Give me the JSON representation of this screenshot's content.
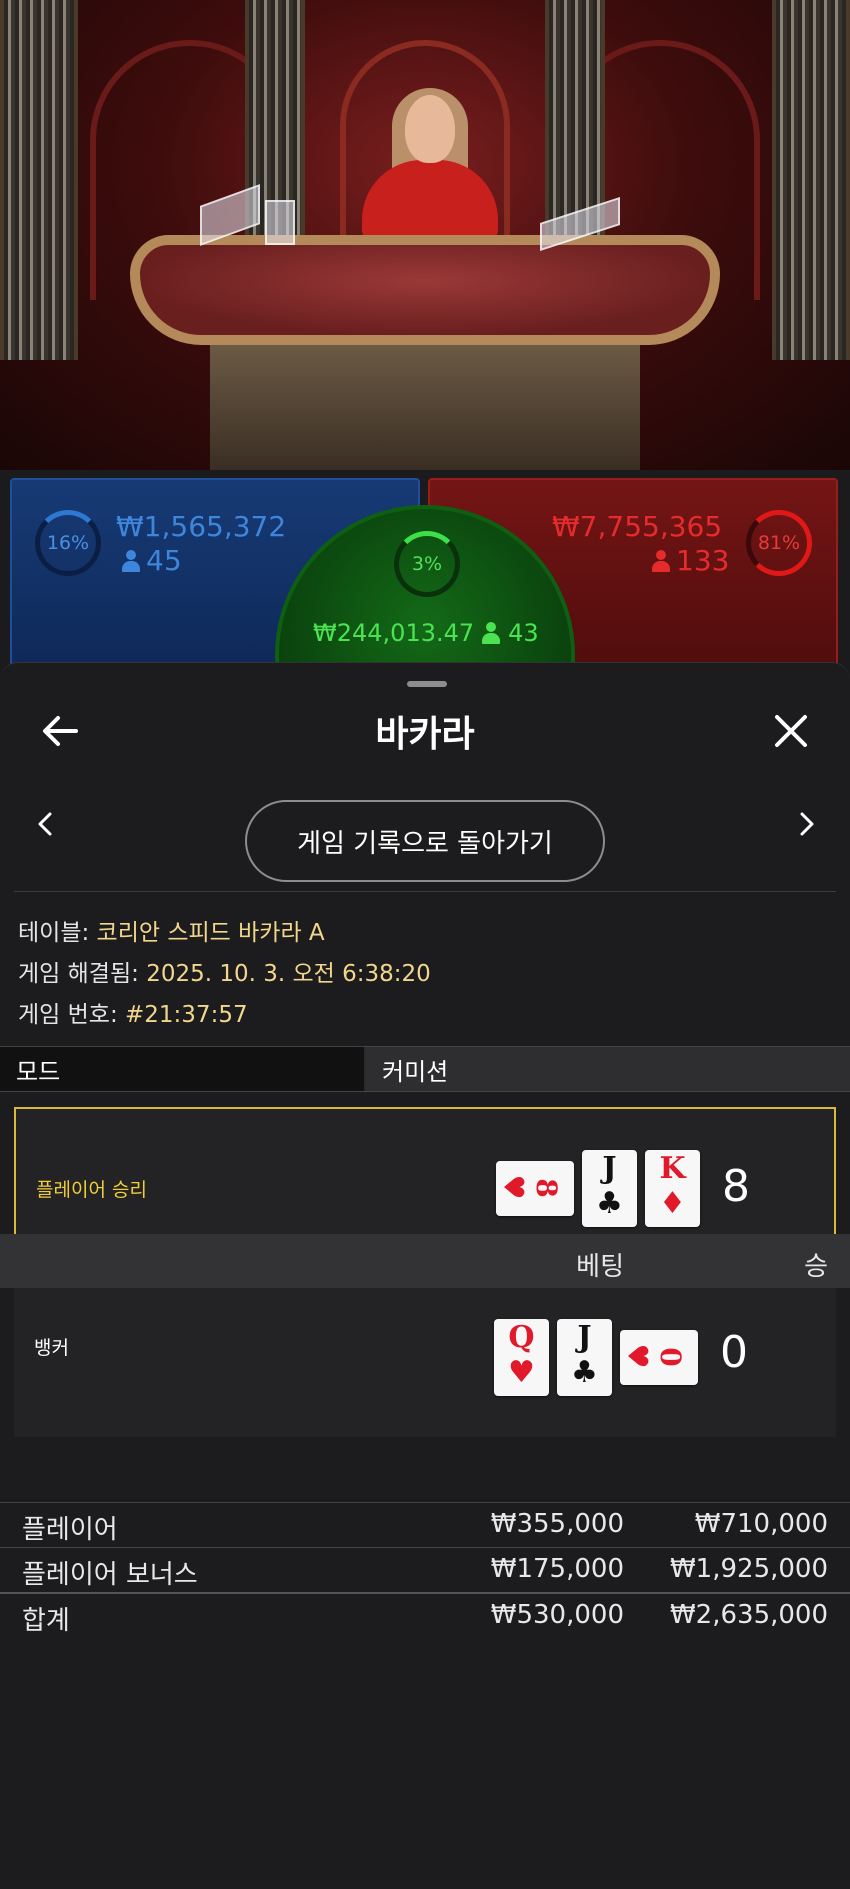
{
  "stats": {
    "player": {
      "percent": "16%",
      "amount": "₩1,565,372",
      "players": "45"
    },
    "tie": {
      "percent": "3%",
      "amount": "₩244,013.47",
      "players": "43"
    },
    "banker": {
      "percent": "81%",
      "amount": "₩7,755,365",
      "players": "133"
    }
  },
  "header": {
    "title": "바카라",
    "back_icon": "arrow-left-icon",
    "close_icon": "close-icon"
  },
  "nav": {
    "back_to_history": "게임 기록으로 돌아가기",
    "prev_icon": "chevron-left-icon",
    "next_icon": "chevron-right-icon"
  },
  "info": {
    "table_label": "테이블:",
    "table_value": "코리안 스피드 바카라 A",
    "resolved_label": "게임 해결됨:",
    "resolved_value": "2025. 10. 3. 오전 6:38:20",
    "number_label": "게임 번호:",
    "number_value": "#21:37:57"
  },
  "tabs": {
    "mode": "모드",
    "commission": "커미션"
  },
  "hands": {
    "player": {
      "label": "플레이어 승리",
      "score": "8",
      "winner": true,
      "cards": [
        {
          "rank": "8",
          "suit": "♥",
          "color": "red",
          "sideways": true
        },
        {
          "rank": "J",
          "suit": "♣",
          "color": "black",
          "sideways": false
        },
        {
          "rank": "K",
          "suit": "♦",
          "color": "red",
          "sideways": false
        }
      ]
    },
    "banker": {
      "label": "뱅커",
      "score": "0",
      "winner": false,
      "cards": [
        {
          "rank": "Q",
          "suit": "♥",
          "color": "red",
          "sideways": false
        },
        {
          "rank": "J",
          "suit": "♣",
          "color": "black",
          "sideways": false
        },
        {
          "rank": "0",
          "suit": "♥",
          "color": "red",
          "sideways": true
        }
      ]
    }
  },
  "bets": {
    "headers": {
      "bet": "베팅",
      "win": "승"
    },
    "rows": [
      {
        "name": "플레이어",
        "bet": "₩355,000",
        "win": "₩710,000"
      },
      {
        "name": "플레이어 보너스",
        "bet": "₩175,000",
        "win": "₩1,925,000"
      }
    ],
    "total": {
      "name": "합계",
      "bet": "₩530,000",
      "win": "₩2,635,000"
    }
  },
  "colors": {
    "player": "#3d86dc",
    "banker": "#e52b2b",
    "tie": "#4be352",
    "highlight": "#d9bb3a"
  }
}
